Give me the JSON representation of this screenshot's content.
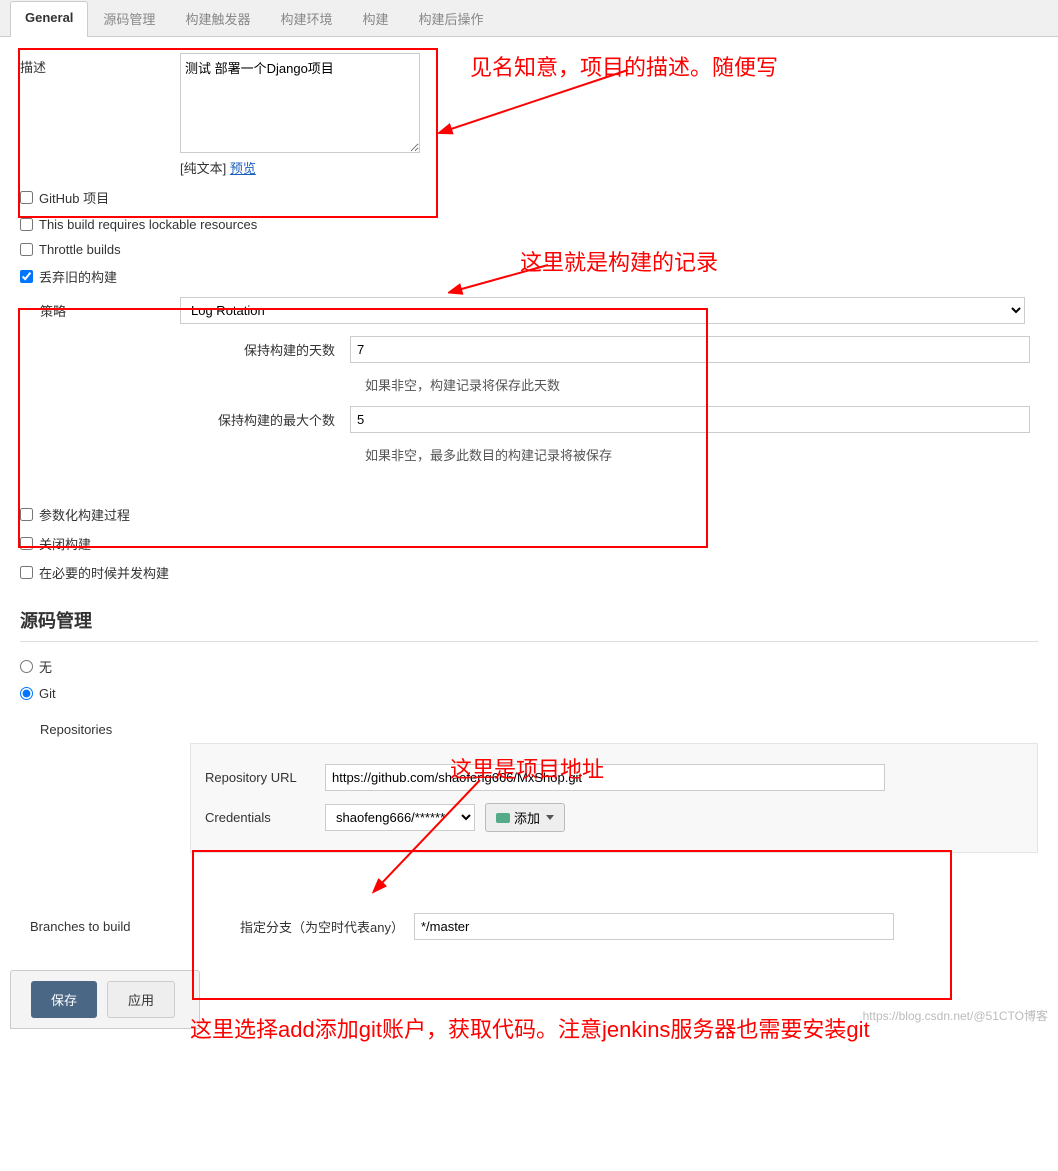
{
  "tabs": {
    "general": "General",
    "scm": "源码管理",
    "triggers": "构建触发器",
    "env": "构建环境",
    "build": "构建",
    "postbuild": "构建后操作"
  },
  "desc": {
    "label": "描述",
    "value": "测试 部署一个Django项目",
    "plaintext": "[纯文本] ",
    "preview": "预览"
  },
  "checks": {
    "github": "GitHub 项目",
    "lockable": "This build requires lockable resources",
    "throttle": "Throttle builds",
    "discard": "丢弃旧的构建",
    "param": "参数化构建过程",
    "disable": "关闭构建",
    "concurrent": "在必要的时候并发构建"
  },
  "strategy": {
    "label": "策略",
    "value": "Log Rotation",
    "days_label": "保持构建的天数",
    "days_value": "7",
    "days_help": "如果非空，构建记录将保存此天数",
    "max_label": "保持构建的最大个数",
    "max_value": "5",
    "max_help": "如果非空，最多此数目的构建记录将被保存"
  },
  "scm_section": {
    "title": "源码管理",
    "none": "无",
    "git": "Git",
    "repos_label": "Repositories",
    "repo_url_label": "Repository URL",
    "repo_url_value": "https://github.com/shaofeng666/MxShop.git",
    "cred_label": "Credentials",
    "cred_value": "shaofeng666/******",
    "add_btn": "添加",
    "branches_label": "Branches to build",
    "branch_spec_label": "指定分支（为空时代表any）",
    "branch_value": "*/master"
  },
  "footer": {
    "save": "保存",
    "apply": "应用"
  },
  "annotations": {
    "a1": "见名知意，项目的描述。随便写",
    "a2": "这里就是构建的记录",
    "a3": "这里是项目地址",
    "a4": "这里选择add添加git账户，获取代码。注意jenkins服务器也需要安装git"
  },
  "watermark": "https://blog.csdn.net/@51CTO博客"
}
